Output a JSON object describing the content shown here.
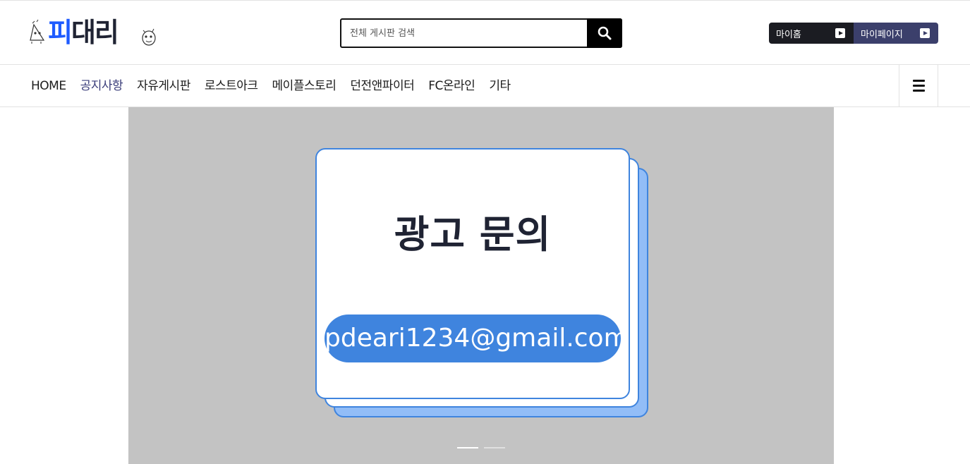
{
  "logo": {
    "text_part1": "피",
    "text_part2": "대리",
    "icon": "mascot-icon"
  },
  "search": {
    "placeholder": "전체 게시판 검색",
    "value": "",
    "icon": "search-icon"
  },
  "quick_links": {
    "my_home": "마이홈",
    "my_page": "마이페이지"
  },
  "nav": {
    "items": [
      {
        "label": "HOME"
      },
      {
        "label": "공지사항"
      },
      {
        "label": "자유게시판"
      },
      {
        "label": "로스트아크"
      },
      {
        "label": "메이플스토리"
      },
      {
        "label": "던전앤파이터"
      },
      {
        "label": "FC온라인"
      },
      {
        "label": "기타"
      }
    ],
    "active_index": 1,
    "menu_icon": "hamburger-icon"
  },
  "banner": {
    "title": "광고 문의",
    "email": "pdeari1234@gmail.com",
    "slides_total": 2,
    "active_slide": 1
  },
  "colors": {
    "accent_blue": "#3f84de",
    "logo_blue": "#1e5bff",
    "navy": "#3b3f6b",
    "dark": "#1b1c22",
    "banner_bg": "#c3c3c3"
  }
}
